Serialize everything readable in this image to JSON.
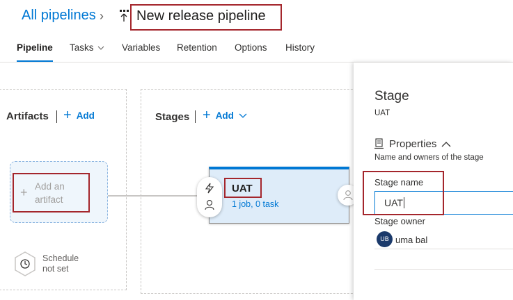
{
  "breadcrumb": {
    "root": "All pipelines",
    "separator": "›",
    "title": "New release pipeline"
  },
  "tabs": [
    {
      "label": "Pipeline"
    },
    {
      "label": "Tasks"
    },
    {
      "label": "Variables"
    },
    {
      "label": "Retention"
    },
    {
      "label": "Options"
    },
    {
      "label": "History"
    }
  ],
  "artifacts": {
    "title": "Artifacts",
    "add_label": "Add",
    "placeholder_line1": "Add an",
    "placeholder_line2": "artifact"
  },
  "schedule": {
    "line1": "Schedule",
    "line2": "not set"
  },
  "stages": {
    "title": "Stages",
    "add_label": "Add"
  },
  "stage_card": {
    "name": "UAT",
    "summary": "1 job, 0 task"
  },
  "side_panel": {
    "title": "Stage",
    "subtitle": "UAT",
    "properties_label": "Properties",
    "properties_desc": "Name and owners of the stage",
    "stage_name_label": "Stage name",
    "stage_name_value": "UAT",
    "stage_owner_label": "Stage owner",
    "owner_initials": "UB",
    "owner_name": "uma bal"
  },
  "colors": {
    "accent": "#0078d4",
    "highlight": "#a4262c",
    "stage_bg": "#deecf9"
  }
}
